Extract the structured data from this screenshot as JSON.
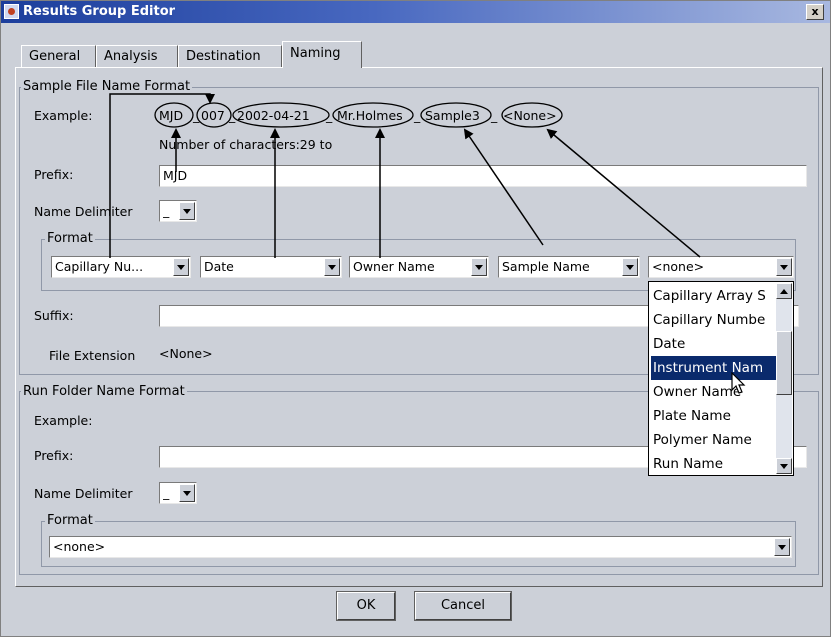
{
  "window": {
    "title": "Results Group Editor",
    "close_label": "x"
  },
  "tabs": [
    {
      "label": "General"
    },
    {
      "label": "Analysis"
    },
    {
      "label": "Destination"
    },
    {
      "label": "Naming"
    }
  ],
  "sample_file": {
    "group_title": "Sample File Name Format",
    "example_label": "Example:",
    "example_parts": [
      "MJD",
      "007",
      "2002-04-21",
      "Mr.Holmes",
      "Sample3",
      "<None>"
    ],
    "example_separators": [
      "_",
      "_",
      "_",
      "_",
      "_"
    ],
    "num_chars": "Number of characters:29 to",
    "prefix_label": "Prefix:",
    "prefix_value": "MJD",
    "delimiter_label": "Name Delimiter",
    "delimiter_value": "_",
    "format_title": "Format",
    "format_combos": [
      "Capillary Nu...",
      "Date",
      "Owner Name",
      "Sample Name",
      "<none>"
    ],
    "suffix_label": "Suffix:",
    "suffix_value": "",
    "ext_label": "File Extension",
    "ext_value": "<None>"
  },
  "dropdown": {
    "items": [
      "Capillary Array S",
      "Capillary Numbe",
      "Date",
      "Instrument Nam",
      "Owner Name",
      "Plate Name",
      "Polymer Name",
      "Run Name"
    ],
    "selected": "Instrument Nam"
  },
  "run_folder": {
    "group_title": "Run Folder Name Format",
    "example_label": "Example:",
    "prefix_label": "Prefix:",
    "prefix_value": "",
    "delimiter_label": "Name Delimiter",
    "delimiter_value": "_",
    "format_title": "Format",
    "format_value": "<none>"
  },
  "buttons": {
    "ok": "OK",
    "cancel": "Cancel"
  },
  "colors": {
    "title_bar": "#1c3e9c",
    "window_bg": "#ccd0d8",
    "selection": "#0a2a6c"
  }
}
